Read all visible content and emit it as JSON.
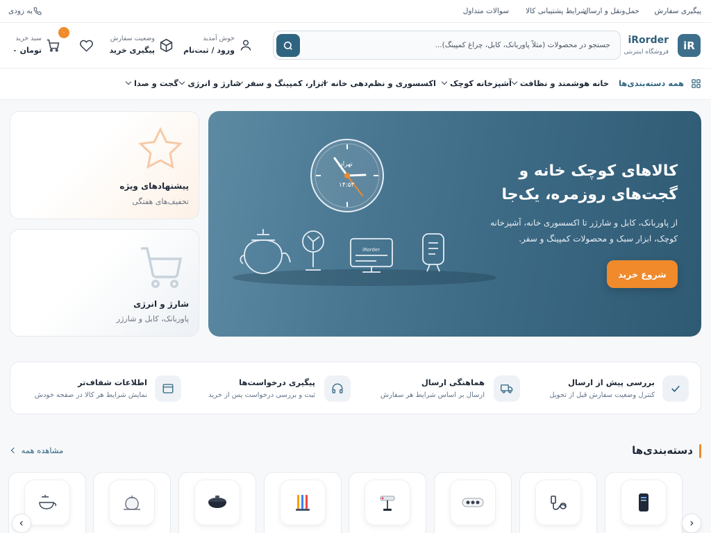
{
  "colors": {
    "primary": "#2f6480",
    "accent": "#f08a2b",
    "hero": "#3c6984"
  },
  "topbar": {
    "links": [
      "پیگیری سفارش",
      "حمل‌ونقل و ارسال",
      "شرایط پشتیبانی کالا",
      "سوالات متداول"
    ],
    "phone": "به زودی"
  },
  "header": {
    "logo_mark": "iR",
    "logo_name": "iRorder",
    "logo_sub": "فروشگاه اینترنتی",
    "search_placeholder": "جستجو در محصولات (مثلاً پاوربانک، کابل، چراغ کمپینگ)...",
    "account_small": "خوش آمدید",
    "account_big": "ورود / ثبت‌نام",
    "order_small": "وضعیت سفارش",
    "order_big": "پیگیری خرید",
    "cart_small": "سبد خرید",
    "cart_big": "تومان ۰",
    "cart_count": "۰"
  },
  "nav": {
    "all_categories": "همه دسته‌بندی‌ها",
    "items": [
      "خانه هوشمند و نظافت",
      "آشپزخانه کوچک",
      "اکسسوری و نظم‌دهی خانه",
      "ابزار، کمپینگ و سفر",
      "شارژ و انرژی",
      "گجت و صدا"
    ]
  },
  "hero": {
    "title": "کالاهای کوچک خانه و گجت‌های روزمره، یک‌جا",
    "desc": "از پاوربانک، کابل و شارژر تا اکسسوری خانه، آشپزخانه کوچک، ابزار سبک و محصولات کمپینگ و سفر.",
    "cta": "شروع خرید",
    "clock_city": "تهران",
    "clock_time": "۱۴:۵۳",
    "monitor_label": "iRorder"
  },
  "side_cards": [
    {
      "title": "پیشنهادهای ویژه",
      "subtitle": "تخفیف‌های هفتگی",
      "icon": "star-icon"
    },
    {
      "title": "شارژ و انرژی",
      "subtitle": "پاوربانک، کابل و شارژر",
      "icon": "cart-icon"
    }
  ],
  "features": [
    {
      "title": "بررسی پیش از ارسال",
      "subtitle": "کنترل وضعیت سفارش قبل از تحویل",
      "icon": "check-icon"
    },
    {
      "title": "هماهنگی ارسال",
      "subtitle": "ارسال بر اساس شرایط هر سفارش",
      "icon": "truck-icon"
    },
    {
      "title": "پیگیری درخواست‌ها",
      "subtitle": "ثبت و بررسی درخواست پس از خرید",
      "icon": "headset-icon"
    },
    {
      "title": "اطلاعات شفاف‌تر",
      "subtitle": "نمایش شرایط هر کالا در صفحه خودش",
      "icon": "window-icon"
    }
  ],
  "categories_section": {
    "title": "دسته‌بندی‌ها",
    "view_all": "مشاهده همه",
    "items": [
      {
        "icon": "powerbank-icon"
      },
      {
        "icon": "cable-icon"
      },
      {
        "icon": "speaker-icon"
      },
      {
        "icon": "lamp-icon"
      },
      {
        "icon": "tools-icon"
      },
      {
        "icon": "pan-icon"
      },
      {
        "icon": "kettle-icon"
      },
      {
        "icon": "steamer-icon"
      }
    ]
  }
}
